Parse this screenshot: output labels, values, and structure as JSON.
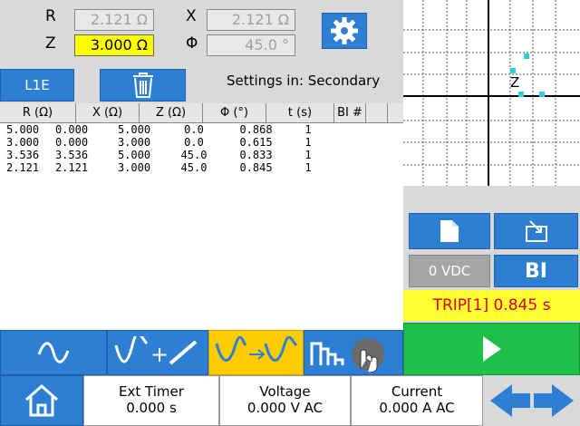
{
  "params": {
    "r_label": "R",
    "r_value": "2.121 Ω",
    "x_label": "X",
    "x_value": "2.121 Ω",
    "z_label": "Z",
    "z_value": "3.000 Ω",
    "phi_label": "Φ",
    "phi_value": "45.0 °"
  },
  "toolbar": {
    "l1e_label": "L1E",
    "settings_text": "Settings in: Secondary"
  },
  "table": {
    "headers": [
      "R (Ω)",
      "X (Ω)",
      "Z (Ω)",
      "Φ (°)",
      "t (s)",
      "BI #"
    ],
    "rows": [
      [
        "5.000",
        "0.000",
        "5.000",
        "0.0",
        "0.868",
        "1"
      ],
      [
        "3.000",
        "0.000",
        "3.000",
        "0.0",
        "0.615",
        "1"
      ],
      [
        "3.536",
        "3.536",
        "5.000",
        "45.0",
        "0.833",
        "1"
      ],
      [
        "2.121",
        "2.121",
        "3.000",
        "45.0",
        "0.845",
        "1"
      ]
    ]
  },
  "plot": {
    "label": "Z"
  },
  "right": {
    "vdc": "0 VDC",
    "bi": "BI",
    "trip": "TRIP[1] 0.845 s"
  },
  "status": {
    "ext_timer_label": "Ext Timer",
    "ext_timer_value": "0.000 s",
    "voltage_label": "Voltage",
    "voltage_value": "0.000 V AC",
    "current_label": "Current",
    "current_value": "0.000 A AC"
  },
  "colors": {
    "accent": "#2d7fd4",
    "active_field": "#ffff00",
    "active_mode": "#ffcc00",
    "play": "#1fc04a",
    "trip_text": "#e00000"
  }
}
